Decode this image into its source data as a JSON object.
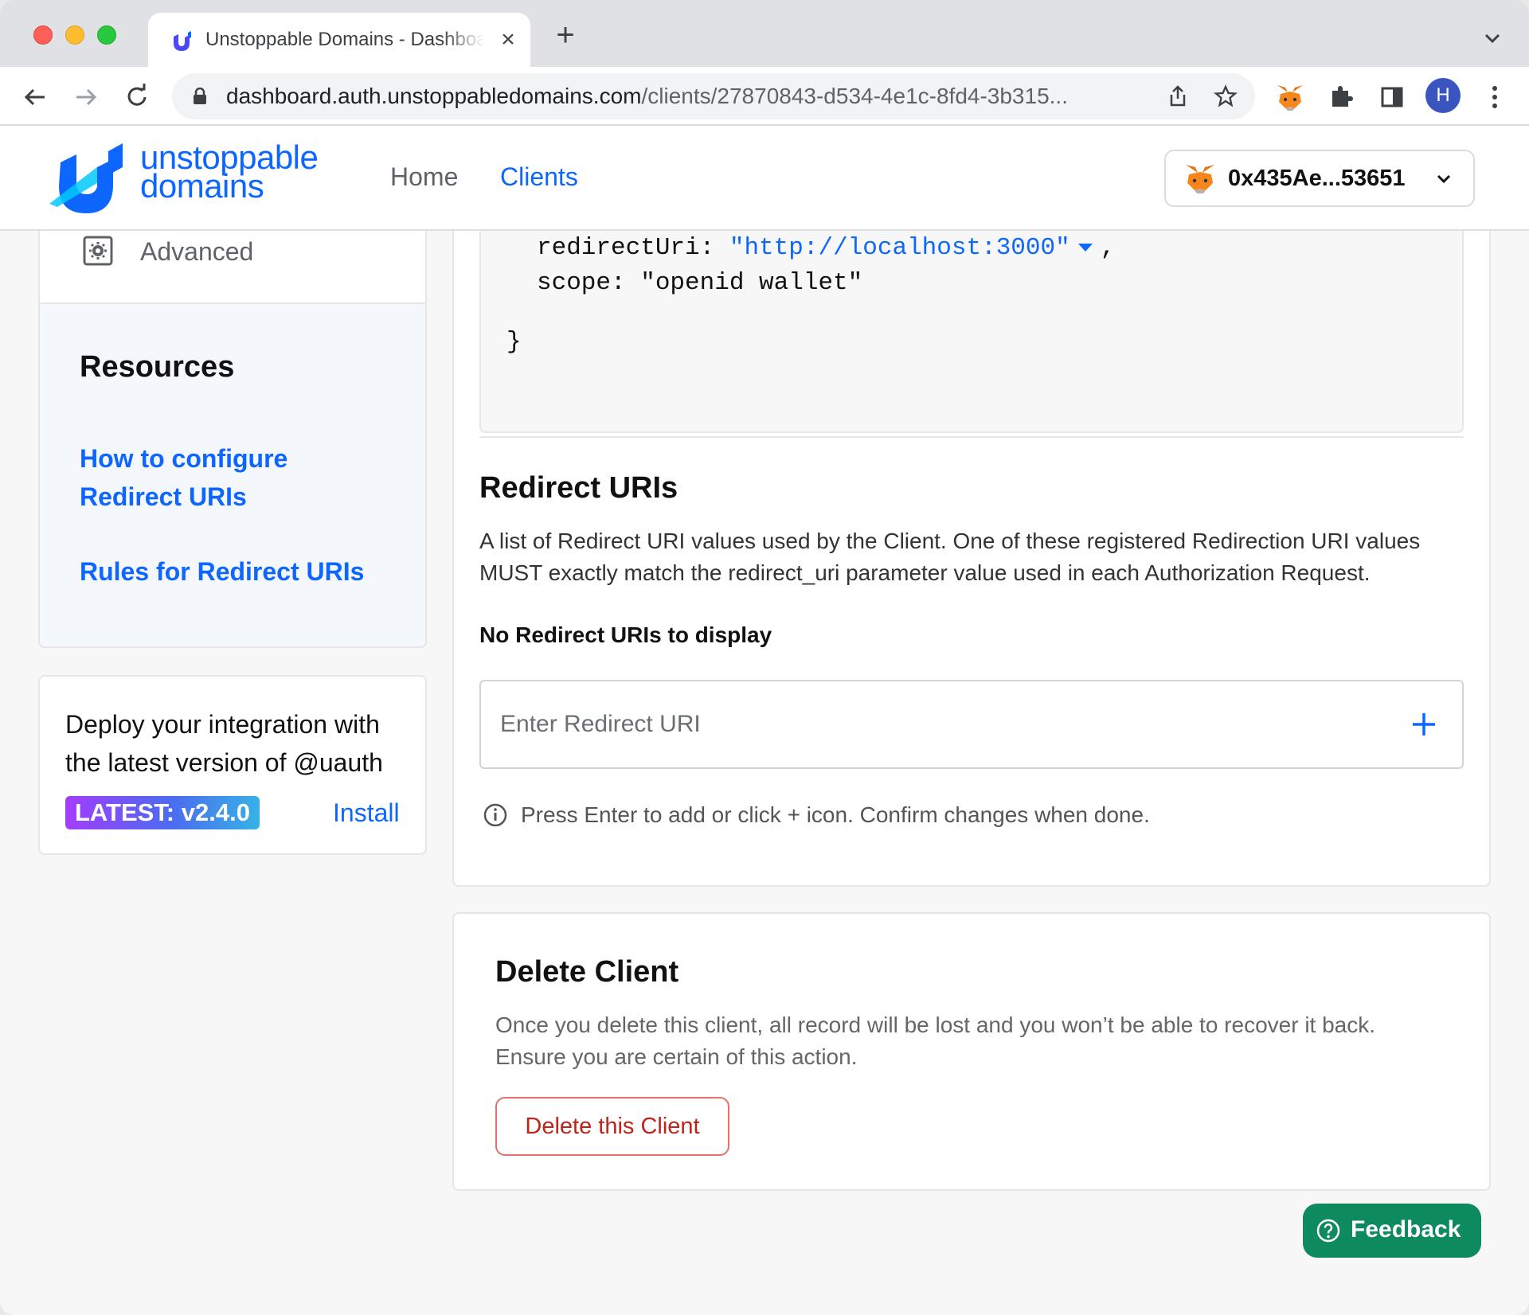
{
  "browser": {
    "tab_title": "Unstoppable Domains - Dashboard",
    "tab_close": "×",
    "new_tab": "+",
    "url_host": "dashboard.auth.unstoppabledomains.com",
    "url_path": "/clients/27870843-d534-4e1c-8fd4-3b315...",
    "profile_initial": "H"
  },
  "header": {
    "logo_line1": "unstoppable",
    "logo_line2": "domains",
    "nav": [
      {
        "label": "Home",
        "active": false
      },
      {
        "label": "Clients",
        "active": true
      }
    ],
    "wallet_address": "0x435Ae...53651"
  },
  "sidebar": {
    "advanced_label": "Advanced",
    "resources_title": "Resources",
    "links": [
      {
        "label_line1": "How to configure",
        "label_line2": "Redirect URIs"
      },
      {
        "label_line1": "Rules for Redirect URIs",
        "label_line2": ""
      }
    ],
    "deploy_text": "Deploy your integration with the latest version of @uauth",
    "latest_badge": "LATEST: v2.4.0",
    "install_label": "Install"
  },
  "code": {
    "line1_key": "redirectUri: ",
    "line1_value": "\"http://localhost:3000\"",
    "line1_suffix": ",",
    "line2": "scope: \"openid wallet\"",
    "closing": "}"
  },
  "redirect_uris": {
    "title": "Redirect URIs",
    "description": "A list of Redirect URI values used by the Client. One of these registered Redirection URI values MUST exactly match the redirect_uri parameter value used in each Authorization Request.",
    "empty_message": "No Redirect URIs to display",
    "input_placeholder": "Enter Redirect URI",
    "input_value": "",
    "hint": "Press Enter to add or click + icon. Confirm changes when done."
  },
  "delete_client": {
    "title": "Delete Client",
    "description": "Once you delete this client, all record will be lost and you won’t be able to recover it back. Ensure you are certain of this action.",
    "button_label": "Delete this Client"
  },
  "feedback_label": "Feedback",
  "colors": {
    "brand_blue": "#0d67fe",
    "danger_red": "#c0231a",
    "feedback_green": "#0e8a5f"
  }
}
